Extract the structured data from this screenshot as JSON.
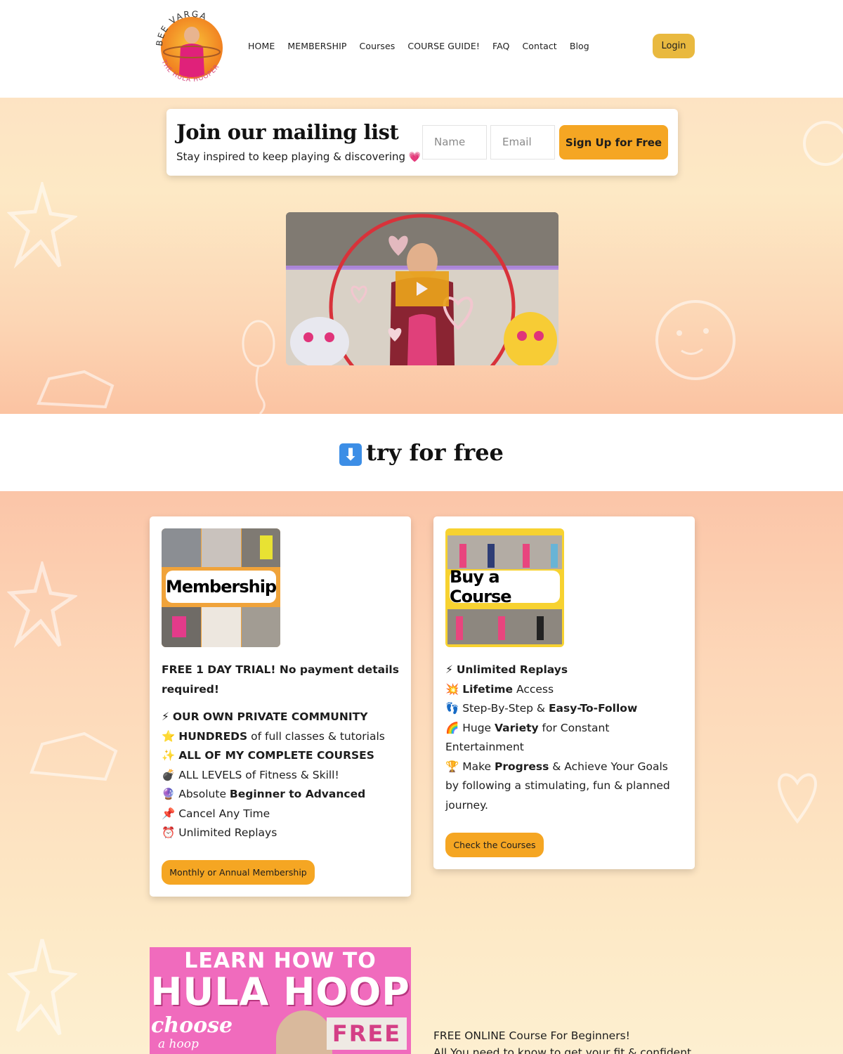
{
  "header": {
    "logo_alt": "Bee Varga The Hula Hooper",
    "logo_text_top": "BEE VARGA",
    "logo_text_bottom": "THE HULA HOOPER",
    "nav": [
      "HOME",
      "MEMBERSHIP",
      "Courses",
      "COURSE GUIDE!",
      "FAQ",
      "Contact",
      "Blog"
    ],
    "login_label": "Login"
  },
  "mailing": {
    "title": "Join our mailing list",
    "subtitle": "Stay inspired to keep playing & discovering",
    "subtitle_icon": "pink-heart-icon",
    "name_placeholder": "Name",
    "email_placeholder": "Email",
    "signup_label": "Sign Up for Free"
  },
  "video": {
    "play_icon": "play-icon"
  },
  "try_free": {
    "arrow": "⬇",
    "title": "try for free"
  },
  "membership_card": {
    "thumb_label": "Membership",
    "intro": "FREE 1 DAY TRIAL! No payment details required!",
    "items": [
      {
        "icon": "⚡",
        "pre": "",
        "bold": "OUR OWN PRIVATE COMMUNITY",
        "post": ""
      },
      {
        "icon": "⭐",
        "pre": "",
        "bold": "HUNDREDS",
        "post": " of full classes & tutorials"
      },
      {
        "icon": "✨",
        "pre": "",
        "bold": "ALL OF MY COMPLETE COURSES",
        "post": ""
      },
      {
        "icon": "💣",
        "pre": "ALL LEVELS of Fitness & Skill!",
        "bold": "",
        "post": ""
      },
      {
        "icon": "🔮",
        "pre": "Absolute ",
        "bold": "Beginner to Advanced",
        "post": ""
      },
      {
        "icon": "📌",
        "pre": "Cancel Any Time",
        "bold": "",
        "post": ""
      },
      {
        "icon": "⏰",
        "pre": "Unlimited Replays",
        "bold": "",
        "post": ""
      }
    ],
    "button_label": "Monthly or Annual Membership"
  },
  "course_card": {
    "thumb_label": "Buy a Course",
    "items": [
      {
        "icon": "⚡",
        "pre": "",
        "bold": "Unlimited Replays",
        "post": ""
      },
      {
        "icon": "💥",
        "pre": "",
        "bold": "Lifetime",
        "post": " Access"
      },
      {
        "icon": "👣",
        "pre": "Step-By-Step & ",
        "bold": "Easy-To-Follow",
        "post": ""
      },
      {
        "icon": "🌈",
        "pre": "Huge ",
        "bold": "Variety",
        "post": " for Constant Entertainment"
      },
      {
        "icon": "🏆",
        "pre": "Make ",
        "bold": "Progress",
        "post": " & Achieve Your Goals by following a stimulating, fun & planned journey."
      }
    ],
    "button_label": "Check the Courses"
  },
  "bottom": {
    "promo_line1": "LEARN HOW TO",
    "promo_line2": "HULA HOOP",
    "promo_choose": "choose",
    "promo_ahoop": "a hoop",
    "promo_free": "FREE",
    "text_line1": "FREE ONLINE Course For Beginners!",
    "text_line2": "All You need to know to get your fit & confident"
  },
  "colors": {
    "accent_orange": "#f5a623",
    "login_yellow": "#e9b93f",
    "promo_pink": "#f06bbd"
  }
}
